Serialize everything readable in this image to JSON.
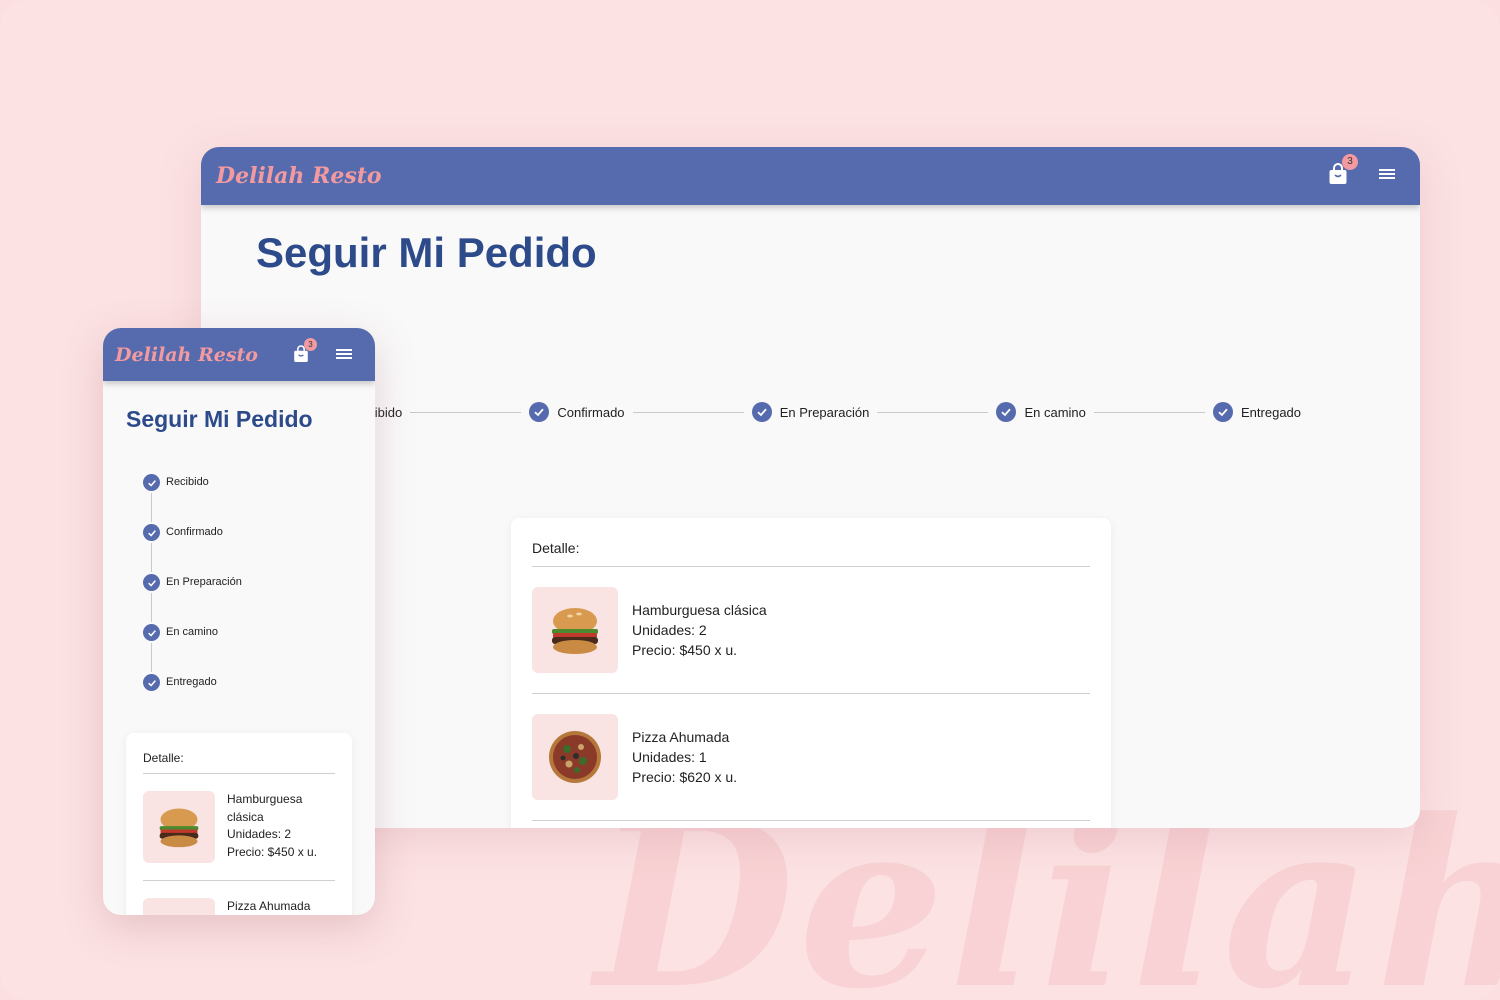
{
  "brand": {
    "logo_text": "Delilah Resto",
    "watermark": "Delilah Re"
  },
  "colors": {
    "navbar": "#566bae",
    "accent": "#f39aa0",
    "title": "#2d4a8a",
    "background": "#fce2e3"
  },
  "header": {
    "cart_count": "3",
    "cart_icon": "shopping-bag-icon",
    "menu_icon": "hamburger-menu-icon"
  },
  "page": {
    "title": "Seguir Mi Pedido"
  },
  "desktop_steps": [
    "ecibido",
    "Confirmado",
    "En Preparación",
    "En camino",
    "Entregado"
  ],
  "mobile_steps": [
    "Recibido",
    "Confirmado",
    "En Preparación",
    "En camino",
    "Entregado"
  ],
  "detail": {
    "label": "Detalle:",
    "items": [
      {
        "name": "Hamburguesa clásica",
        "units": "Unidades: 2",
        "price": "Precio: $450 x u."
      },
      {
        "name": "Pizza Ahumada",
        "units": "Unidades: 1",
        "price": "Precio: $620 x u."
      }
    ],
    "mobile_first_name_line1": "Hamburguesa",
    "mobile_first_name_line2": "clásica",
    "mobile_second_name_partial": "Pizza Ahumada"
  }
}
